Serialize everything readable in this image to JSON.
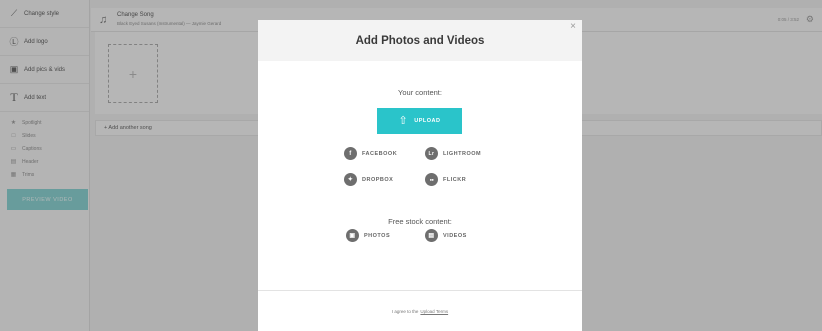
{
  "sidebar": {
    "items": [
      {
        "label": "Change style",
        "icon": "brush-icon"
      },
      {
        "label": "Add logo",
        "icon": "logo-icon"
      },
      {
        "label": "Add pics & vids",
        "icon": "image-icon"
      },
      {
        "label": "Add text",
        "icon": "text-icon"
      }
    ],
    "sub_items": [
      {
        "label": "Spotlight",
        "icon": "star-icon"
      },
      {
        "label": "Slides",
        "icon": "square-icon"
      },
      {
        "label": "Captions",
        "icon": "caption-icon"
      },
      {
        "label": "Header",
        "icon": "header-icon"
      },
      {
        "label": "Trims",
        "icon": "trim-icon"
      }
    ],
    "preview_label": "PREVIEW VIDEO"
  },
  "song": {
    "title": "Change Song",
    "subtitle": "Black Eyed Susans (Instrumental) — Jaymie Gerard",
    "time": "0:05 / 3:52"
  },
  "media": {
    "add_glyph": "+",
    "add_song_label": "+ Add another song"
  },
  "modal": {
    "title": "Add Photos and Videos",
    "close_glyph": "×",
    "your_content_label": "Your content:",
    "upload_label": "UPLOAD",
    "sources": [
      {
        "label": "FACEBOOK",
        "glyph": "f"
      },
      {
        "label": "LIGHTROOM",
        "glyph": "Lr"
      },
      {
        "label": "DROPBOX",
        "glyph": "✦"
      },
      {
        "label": "FLICKR",
        "glyph": "●●"
      }
    ],
    "stock_label": "Free stock content:",
    "stock": [
      {
        "label": "PHOTOS",
        "glyph": "▣"
      },
      {
        "label": "VIDEOS",
        "glyph": "▤"
      }
    ],
    "footer_text": "I agree to the",
    "footer_link": "Upload Terms"
  },
  "colors": {
    "accent": "#2ac4ca",
    "preview_button": "#6fc9c8",
    "source_icon": "#6e6e6e"
  }
}
